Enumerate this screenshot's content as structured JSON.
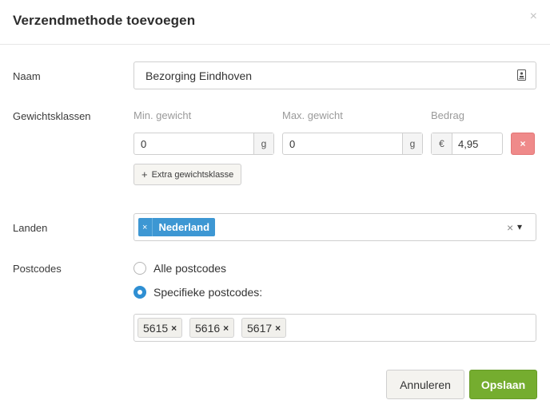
{
  "dialog": {
    "title": "Verzendmethode toevoegen",
    "close_glyph": "×"
  },
  "name_field": {
    "label": "Naam",
    "value": "Bezorging Eindhoven",
    "icon": "contact-card-icon"
  },
  "weight_classes": {
    "label": "Gewichtsklassen",
    "col_min": "Min. gewicht",
    "col_max": "Max. gewicht",
    "col_amount": "Bedrag",
    "row": {
      "min_value": "0",
      "min_unit": "g",
      "max_value": "0",
      "max_unit": "g",
      "currency": "€",
      "amount": "4,95",
      "delete_glyph": "×"
    },
    "add_button": "Extra gewichtsklasse",
    "add_glyph": "+"
  },
  "countries": {
    "label": "Landen",
    "selected": [
      {
        "label": "Nederland",
        "remove_glyph": "×"
      }
    ],
    "clear_glyph": "×",
    "dropdown_glyph": "▾"
  },
  "postcodes": {
    "label": "Postcodes",
    "options": [
      {
        "label": "Alle postcodes",
        "checked": false
      },
      {
        "label": "Specifieke postcodes:",
        "checked": true
      }
    ],
    "tags": [
      {
        "label": "5615",
        "remove_glyph": "×"
      },
      {
        "label": "5616",
        "remove_glyph": "×"
      },
      {
        "label": "5617",
        "remove_glyph": "×"
      }
    ]
  },
  "footer": {
    "cancel_label": "Annuleren",
    "save_label": "Opslaan"
  },
  "colors": {
    "primary_blue": "#3d97d3",
    "save_green": "#75ad2f",
    "delete_red": "#ef8a8a"
  }
}
